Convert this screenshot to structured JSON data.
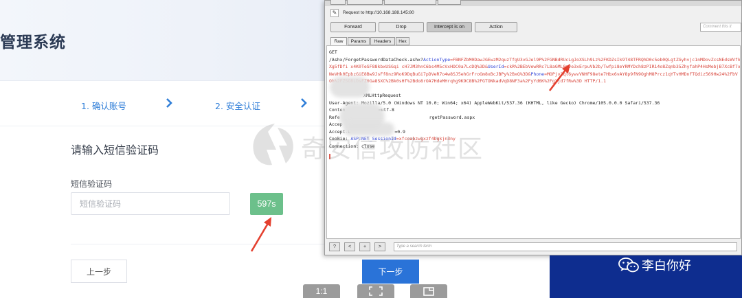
{
  "app": {
    "title": "管理系统",
    "steps": [
      "1. 确认账号",
      "2. 安全认证"
    ],
    "form_title": "请输入短信验证码",
    "field_label": "短信验证码",
    "input_placeholder": "短信验证码",
    "countdown": "597s",
    "prev_label": "上一步",
    "next_label": "下一步"
  },
  "burp": {
    "request_to": "Request to http://10.168.188.145:80",
    "buttons": {
      "forward": "Forward",
      "drop": "Drop",
      "intercept": "Intercept is on",
      "action": "Action"
    },
    "comment_placeholder": "Comment this it",
    "subtabs": [
      "Raw",
      "Params",
      "Headers",
      "Hex"
    ],
    "request": {
      "method": "GET",
      "path_prefix": "/Ashx/ForgetPasswordDataCheck.ashx?",
      "action_key": "ActionType",
      "action_value": "=FBNFZbM0DawJGEwzM2quzTfgU3vGJel9P%2FGNBdRUcLgJoXSLh9Lz%2FKDZsIk9T48TFRQhD0c5eb0QLgtZGyhvjc1nMDovZcsNEdsWVfk%2B",
      "line2_a": "Xg5fDfi x4K0TeSF88kbxUSGqi cH7JM3hnC6bs4M5cVxHOC0a7LcDQ%3D&",
      "userid_key": "UserId",
      "line2_b": "=ckR%2BEbVewRRc7L8aGML0zve3xErpuVb2b/Twfpi8eYRMYDch8zPIR14o8Zqnb35ZhyfahP4HsMebjB7XcBf7xC7",
      "line3_a": "NeVHk0EpbzGiE8Bw9JsFf8nz9RoK9DqBuGi7pDVeR7o4w8SJ5ehGrFroGm8xBcJBPy%2BxQ%3D&",
      "phone_key": "Phone",
      "line3_b": "=MOPjv2ql6ywvVNHF98ete7Hbx6vAY8p9fN9OghM8Prcz1qYTvHMDnfTQdiz569Hw24%2FbV",
      "line4": "Oh%2FZSO8LDsFZ0Ga8SXC%2Bk0sHf%2Bdo8rOA7HdeMHrqhg9K9C8B%2FGTONkadVqD8NF3a%2FyYd6K%2FgXjd7fRw%3D HTTP/1.1",
      "xhr_line": "XMLHttpRequest",
      "user_agent": "User-Agent: Mozilla/5.0 (Windows NT 10.0; Win64; x64) AppleWebKit/537.36 (KHTML, like Gecko) Chrome/105.0.0.0 Safari/537.36",
      "content_line": "Conten",
      "content_suffix": "=utf-8",
      "referer_line": "Refe",
      "referer_suffix": "rgetPassword.aspx",
      "accept_line": "Accep",
      "accept_lang_line": "Accept-L",
      "accept_lang_suffix": "=0.9",
      "cookie_prefix": "Cookie: ",
      "cookie_key": "ASP.NET_SessionId",
      "cookie_value": "=xfcoabzwgxzf4bgkjn3ny",
      "connection": "Connection: close"
    },
    "search_placeholder": "Type a search term",
    "foot_buttons": [
      "?",
      "<",
      "+",
      ">"
    ]
  },
  "watermark": "奇安信攻防社区",
  "wechat_account": "李白你好",
  "viewer": {
    "zoom_label": "1:1"
  },
  "colors": {
    "accent_blue": "#2a73d8",
    "countdown_green": "#6cc08b",
    "annotation_red": "#e4402f",
    "request_red": "#d8453b"
  }
}
